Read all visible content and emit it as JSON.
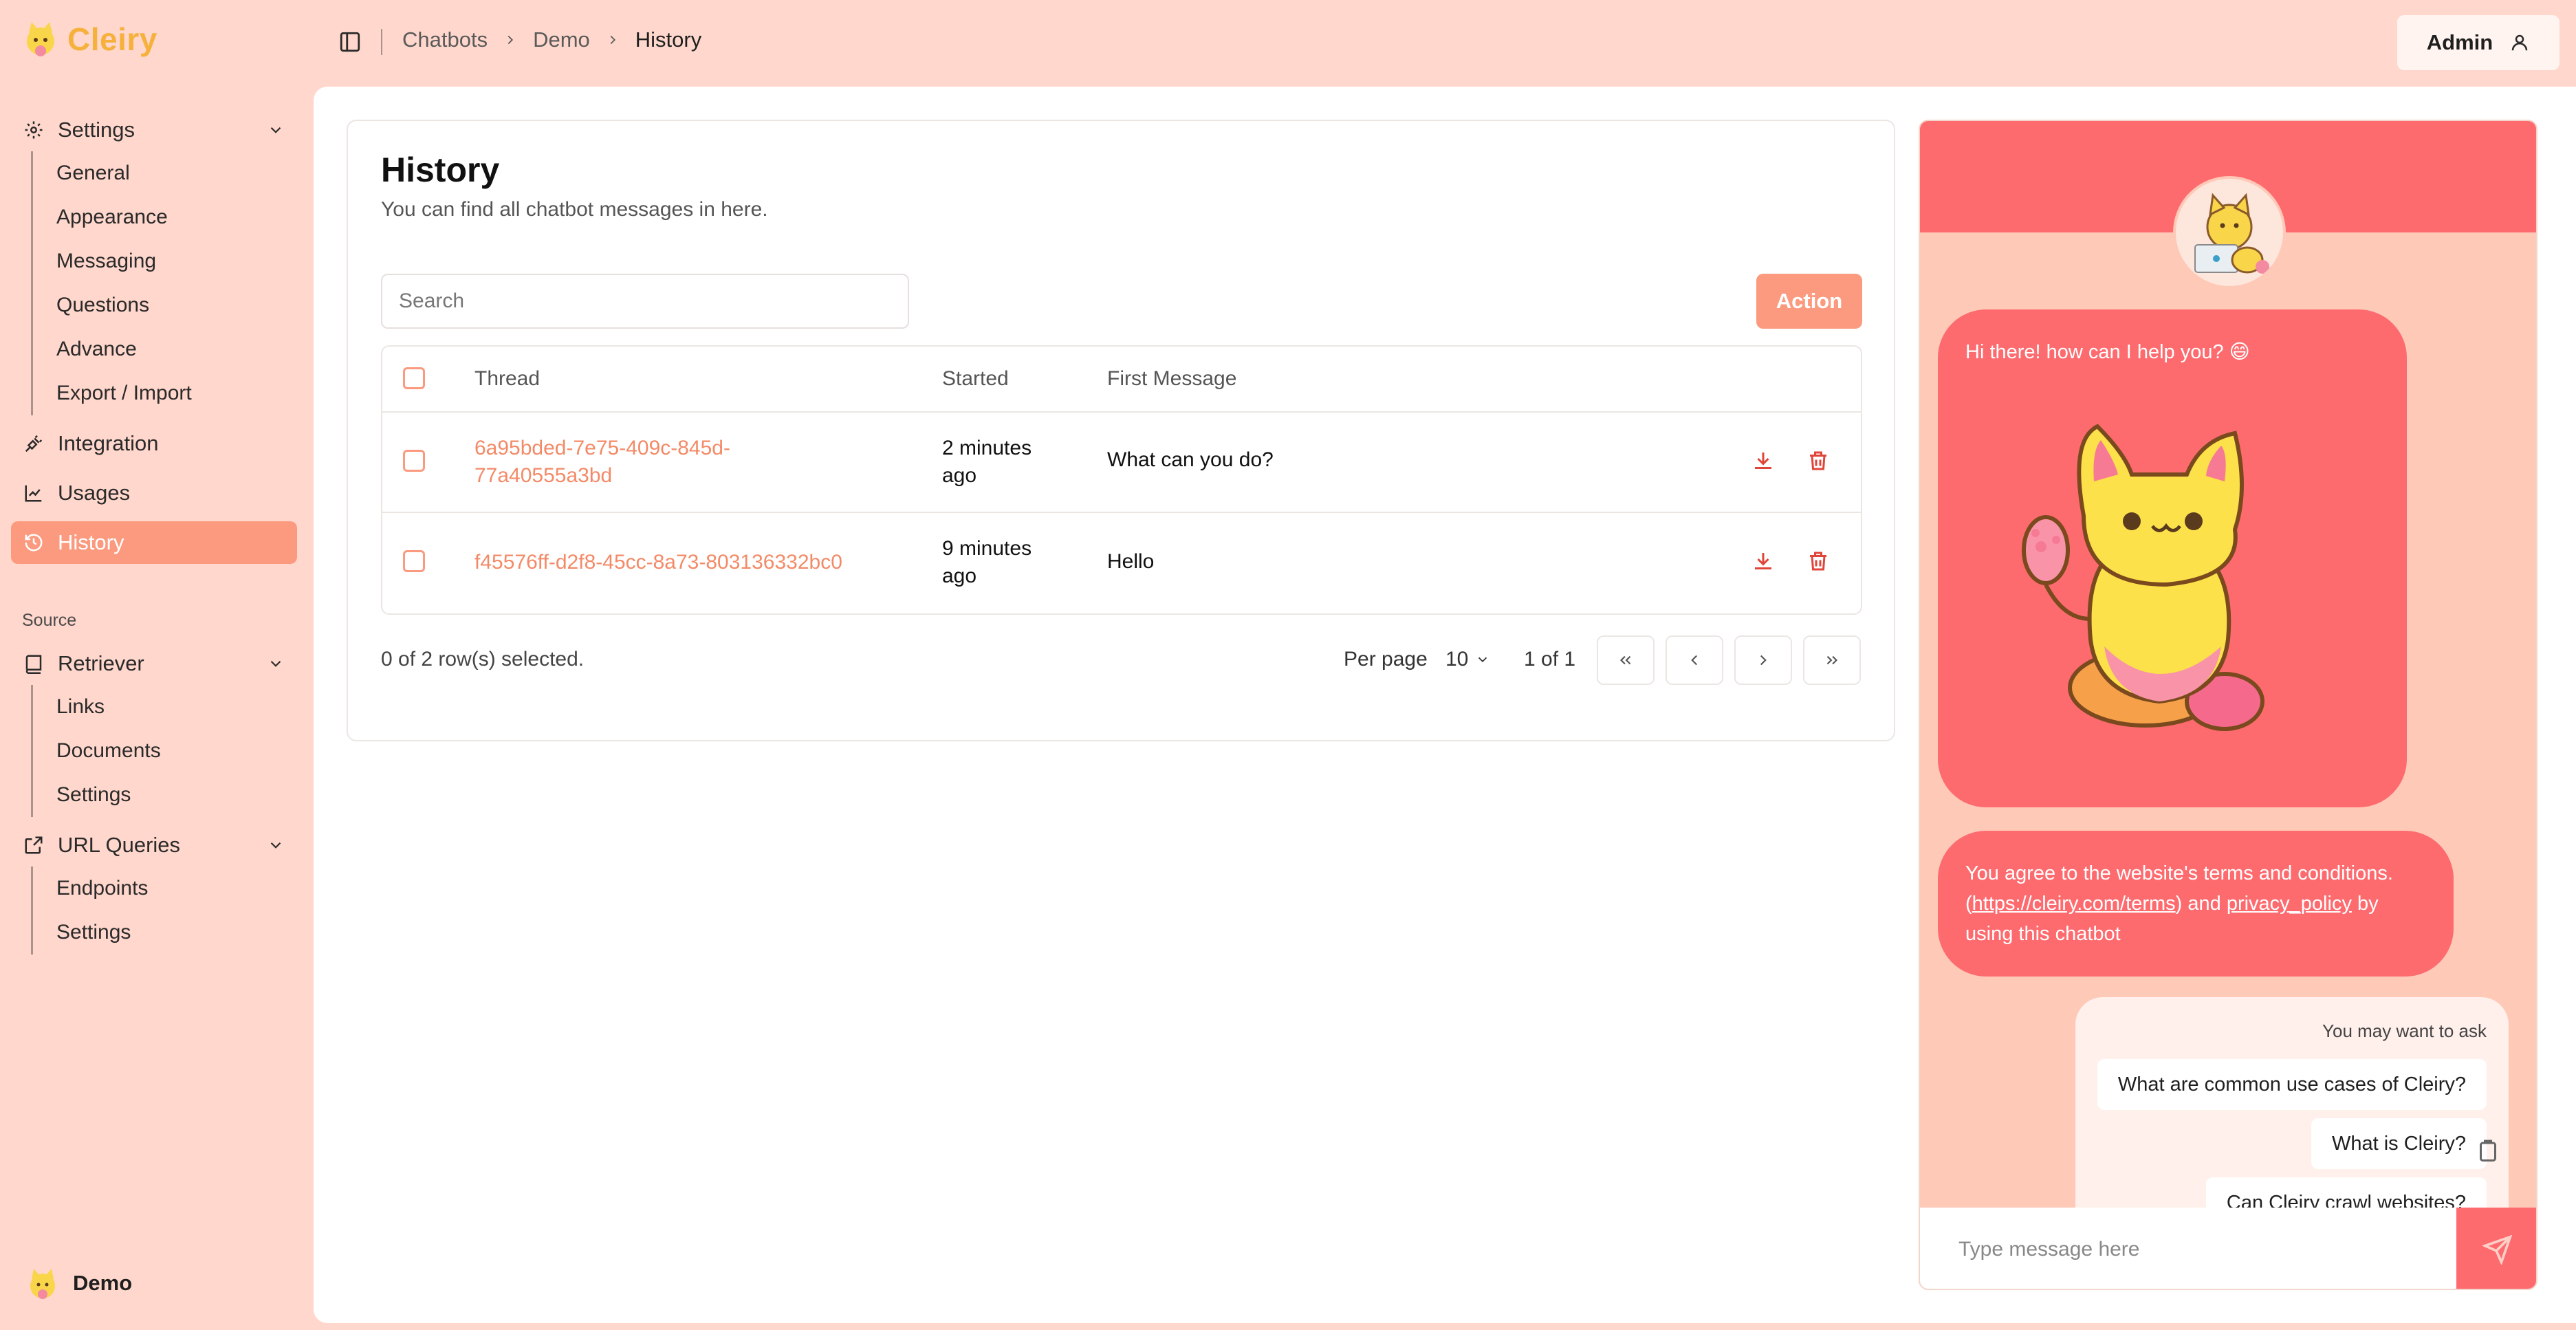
{
  "app": {
    "name": "Cleiry"
  },
  "breadcrumb": [
    "Chatbots",
    "Demo",
    "History"
  ],
  "user": {
    "name": "Admin"
  },
  "sidebar": {
    "settings": {
      "label": "Settings",
      "items": [
        "General",
        "Appearance",
        "Messaging",
        "Questions",
        "Advance",
        "Export / Import"
      ]
    },
    "integration": "Integration",
    "usages": "Usages",
    "history": "History",
    "source_label": "Source",
    "retriever": {
      "label": "Retriever",
      "items": [
        "Links",
        "Documents",
        "Settings"
      ]
    },
    "url_queries": {
      "label": "URL Queries",
      "items": [
        "Endpoints",
        "Settings"
      ]
    },
    "bottom_bot": "Demo"
  },
  "history": {
    "title": "History",
    "description": "You can find all chatbot messages in here.",
    "search_placeholder": "Search",
    "action_label": "Action",
    "columns": {
      "thread": "Thread",
      "started": "Started",
      "first_message": "First Message"
    },
    "rows": [
      {
        "thread": "6a95bded-7e75-409c-845d-77a40555a3bd",
        "started": "2 minutes ago",
        "first_message": "What can you do?"
      },
      {
        "thread": "f45576ff-d2f8-45cc-8a73-803136332bc0",
        "started": "9 minutes ago",
        "first_message": "Hello"
      }
    ],
    "selection_text": "0 of 2 row(s) selected.",
    "per_page_label": "Per page",
    "per_page_value": "10",
    "page_info": "1 of 1"
  },
  "chat": {
    "greeting": "Hi there! how can I help you? 😄",
    "terms_prefix": "You agree to the website's terms and conditions. (",
    "terms_link": "https://cleiry.com/terms",
    "terms_middle": ") and ",
    "privacy_link": "privacy_policy",
    "terms_suffix": " by using this chatbot",
    "suggest_label": "You may want to ask",
    "suggestions": [
      "What are common use cases of Cleiry?",
      "What is Cleiry?",
      "Can Cleiry crawl websites?"
    ],
    "input_placeholder": "Type message here"
  },
  "colors": {
    "accent": "#fb9a7f",
    "link": "#f38a67",
    "chat_primary": "#fd6b6f",
    "background": "#ffd7cc",
    "danger": "#e0453a"
  },
  "icons": {
    "settings": "gear-icon",
    "integration": "plug-icon",
    "usages": "chart-icon",
    "history": "history-icon",
    "retriever": "book-icon",
    "url_queries": "external-link-icon",
    "download": "download-icon",
    "delete": "trash-icon",
    "send": "send-icon",
    "user": "user-icon",
    "sidebar_toggle": "panel-left-icon"
  }
}
